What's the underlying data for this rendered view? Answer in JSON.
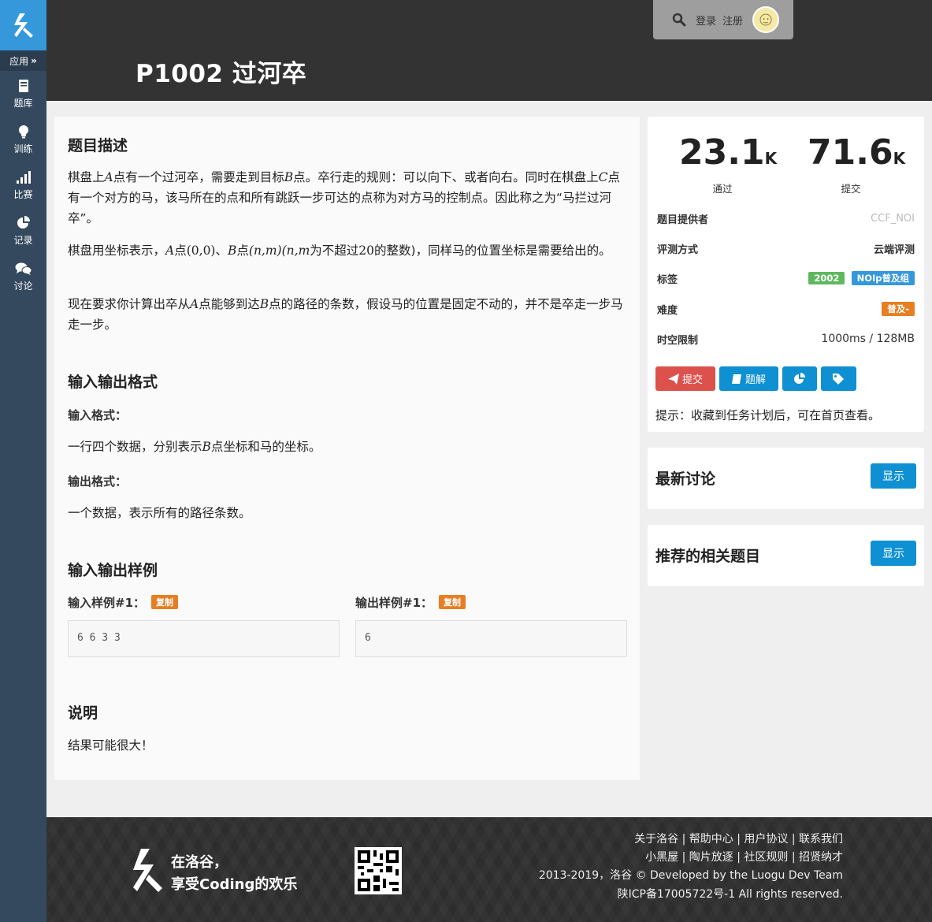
{
  "sidebar": {
    "apps_label": "应用",
    "items": [
      {
        "label": "题库",
        "icon": "book-icon"
      },
      {
        "label": "训练",
        "icon": "lightbulb-icon"
      },
      {
        "label": "比赛",
        "icon": "signal-bars-icon"
      },
      {
        "label": "记录",
        "icon": "pie-chart-icon"
      },
      {
        "label": "讨论",
        "icon": "chat-bubbles-icon"
      }
    ]
  },
  "header": {
    "title": "P1002 过河卒",
    "login": "登录",
    "register": "注册"
  },
  "problem": {
    "desc_title": "题目描述",
    "desc_p1": {
      "a": "棋盘上",
      "A": "A",
      "b": "点有一个过河卒，需要走到目标",
      "B": "B",
      "c": "点。卒行走的规则：可以向下、或者向右。同时在棋盘上",
      "C": "C",
      "d": "点有一个对方的马，该马所在的点和所有跳跃一步可达的点称为对方马的控制点。因此称之为“马拦过河卒”。"
    },
    "desc_p2": {
      "a": "棋盘用坐标表示，",
      "A": "A",
      "b": "点",
      "origin": "(0,0)",
      "c": "、",
      "B": "B",
      "d": "点",
      "nm": "(n,m)",
      "nm2": "(n,m",
      "e": "为不超过",
      "twenty": "20",
      "f": "的整数)，同样马的位置坐标是需要给出的。"
    },
    "desc_p3": {
      "a": "现在要求你计算出卒从",
      "A": "A",
      "b": "点能够到达",
      "B": "B",
      "c": "点的路径的条数，假设马的位置是固定不动的，并不是卒走一步马走一步。"
    },
    "io_title": "输入输出格式",
    "input_label": "输入格式：",
    "input_text": {
      "a": "一行四个数据，分别表示",
      "B": "B",
      "b": "点坐标和马的坐标。"
    },
    "output_label": "输出格式：",
    "output_text": "一个数据，表示所有的路径条数。",
    "sample_title": "输入输出样例",
    "sample_in_label": "输入样例#1：",
    "sample_out_label": "输出样例#1：",
    "copy_label": "复制",
    "sample_in": "6 6 3 3",
    "sample_out": "6",
    "note_title": "说明",
    "note_text": "结果可能很大！"
  },
  "info": {
    "passed_num": "23.1",
    "passed_unit": "K",
    "passed_label": "通过",
    "submit_num": "71.6",
    "submit_unit": "K",
    "submit_label": "提交",
    "provider_key": "题目提供者",
    "provider_val": "CCF_NOI",
    "judge_key": "评测方式",
    "judge_val": "云端评测",
    "tags_key": "标签",
    "tag1": "2002",
    "tag2": "NOIp普及组",
    "difficulty_key": "难度",
    "difficulty_val": "普及-",
    "limit_key": "时空限制",
    "limit_val": "1000ms / 128MB",
    "btn_submit": "提交",
    "btn_solution": "题解",
    "hint": "提示：收藏到任务计划后，可在首页查看。",
    "colors": {
      "tag1": "#5eb95e",
      "tag2": "#3498db",
      "difficulty": "#e67e22",
      "submit": "#dd514c",
      "primary": "#0e90d2"
    }
  },
  "discussions": {
    "title": "最新讨论",
    "button": "显示"
  },
  "related": {
    "title": "推荐的相关题目",
    "button": "显示"
  },
  "footer": {
    "slogan1": "在洛谷，",
    "slogan2": "享受Coding的欢乐",
    "links1": "关于洛谷 | 帮助中心 | 用户协议 | 联系我们",
    "links2": "小黑屋 | 陶片放逐 | 社区规则 | 招贤纳才",
    "copyright": "2013-2019，洛谷 © Developed by the Luogu Dev Team",
    "icp": "陕ICP备17005722号-1 All rights reserved."
  }
}
